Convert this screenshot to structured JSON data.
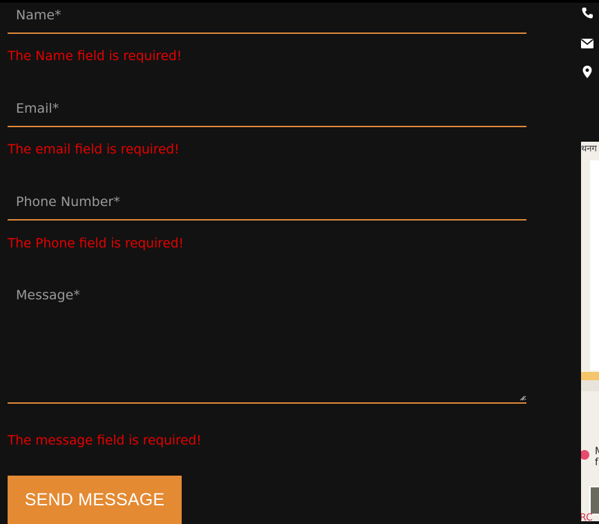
{
  "form": {
    "name_placeholder": "Name*",
    "name_error": "The Name field is required!",
    "email_placeholder": "Email*",
    "email_error": "The email field is required!",
    "phone_placeholder": "Phone Number*",
    "phone_error": "The Phone field is required!",
    "message_placeholder": "Message*",
    "message_error": "The message field is required!",
    "send_label": "SEND MESSAGE"
  },
  "contact": {
    "icons": [
      "phone-icon",
      "envelope-icon",
      "map-marker-icon"
    ]
  },
  "map": {
    "top_label": "थनग",
    "place_label_1": "M",
    "place_label_2": "f",
    "bottom_label": "RC"
  },
  "colors": {
    "background": "#121212",
    "accent": "#e48a33",
    "error": "#e60000",
    "placeholder": "#9a9a9a"
  }
}
